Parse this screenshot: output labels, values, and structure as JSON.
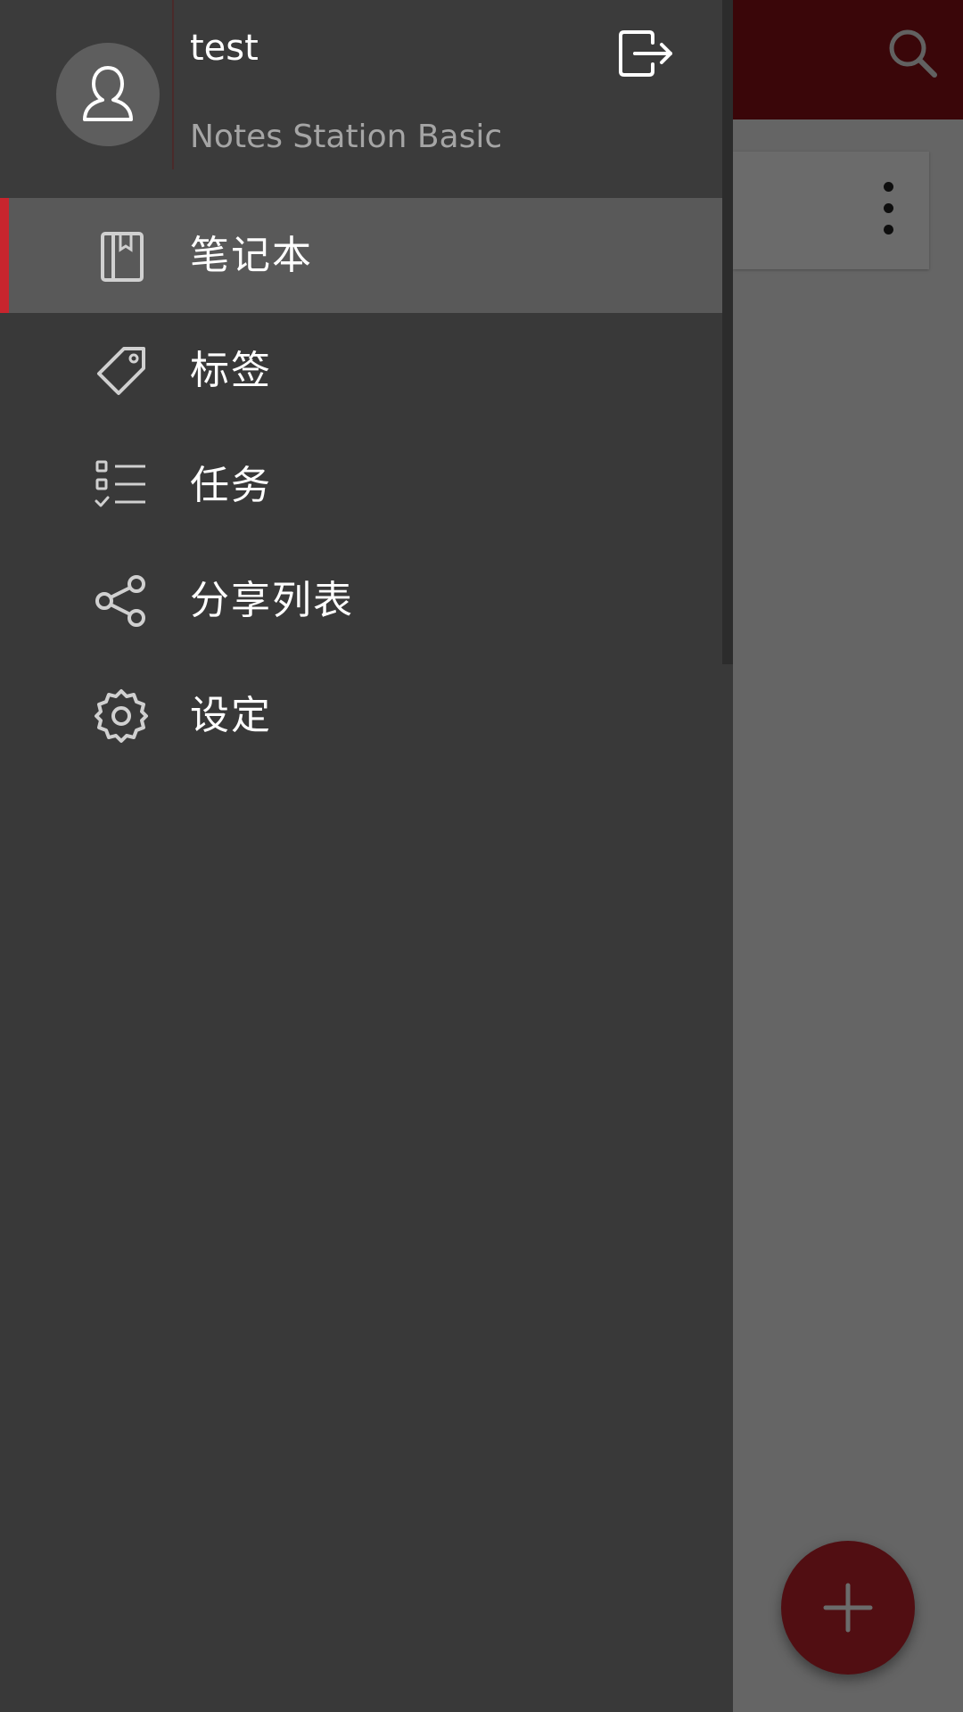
{
  "header": {
    "username": "test",
    "app_name": "Notes Station Basic"
  },
  "nav": {
    "items": [
      {
        "label": "笔记本",
        "icon": "notebook-icon",
        "active": true
      },
      {
        "label": "标签",
        "icon": "tag-icon",
        "active": false
      },
      {
        "label": "任务",
        "icon": "task-list-icon",
        "active": false
      },
      {
        "label": "分享列表",
        "icon": "share-icon",
        "active": false
      },
      {
        "label": "设定",
        "icon": "settings-gear-icon",
        "active": false
      }
    ]
  },
  "colors": {
    "accent": "#c8252e",
    "drawer_bg": "#393939",
    "active_item_bg": "#595959",
    "app_bar": "#8a0f16"
  }
}
